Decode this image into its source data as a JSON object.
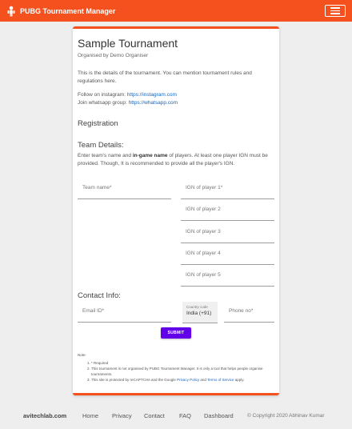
{
  "navbar": {
    "title": "PUBG Tournament Manager",
    "icon": "controller-icon",
    "toggle_icon": "hamburger-icon",
    "accent": "#f4511e"
  },
  "tournament": {
    "title": "Sample Tournament",
    "organiser": "Organised by Demo Organiser",
    "description": "This is the details of the tournament. You can mention tournament rules and regulations here.",
    "instagram_label": "Follow on instagram: ",
    "instagram_link": "https://instagram.com",
    "whatsapp_label": "Join whatsapp group: ",
    "whatsapp_link": "https://whatsapp.com"
  },
  "registration": {
    "heading": "Registration",
    "team_heading": "Team Details:",
    "team_desc_1": "Enter team's name and ",
    "team_desc_bold": "in-game name",
    "team_desc_2": " of players. At least one player IGN must be provided. Though, It is recommended to provide all the player's IGN.",
    "team_name_label": "Team name*",
    "players": [
      "IGN of player 1*",
      "IGN of player 2",
      "IGN of player 3",
      "IGN of player 4",
      "IGN of player 5"
    ],
    "contact_heading": "Contact Info:",
    "email_label": "Email ID*",
    "country_label": "Country code",
    "country_value": "India (+91)",
    "phone_label": "Phone no*",
    "submit_label": "SUBMIT",
    "submit_color": "#6200ea"
  },
  "notes": {
    "label": "Note:",
    "items": [
      "* Required",
      "This tournament is not organised by PUBG Tournament Manager. It is only a tool that helps people organise tournaments."
    ],
    "recaptcha_1": "This site is protected by reCAPTCHA and the Google ",
    "privacy_link": "Privacy Policy",
    "recaptcha_2": " and ",
    "terms_link": "Terms of Service",
    "recaptcha_3": " apply."
  },
  "footer": {
    "site": "avitechlab.com",
    "links": [
      "Home",
      "Privacy",
      "Contact",
      "FAQ",
      "Dashboard"
    ],
    "copyright": "© Copyright 2020 Abhinav Kumar"
  }
}
